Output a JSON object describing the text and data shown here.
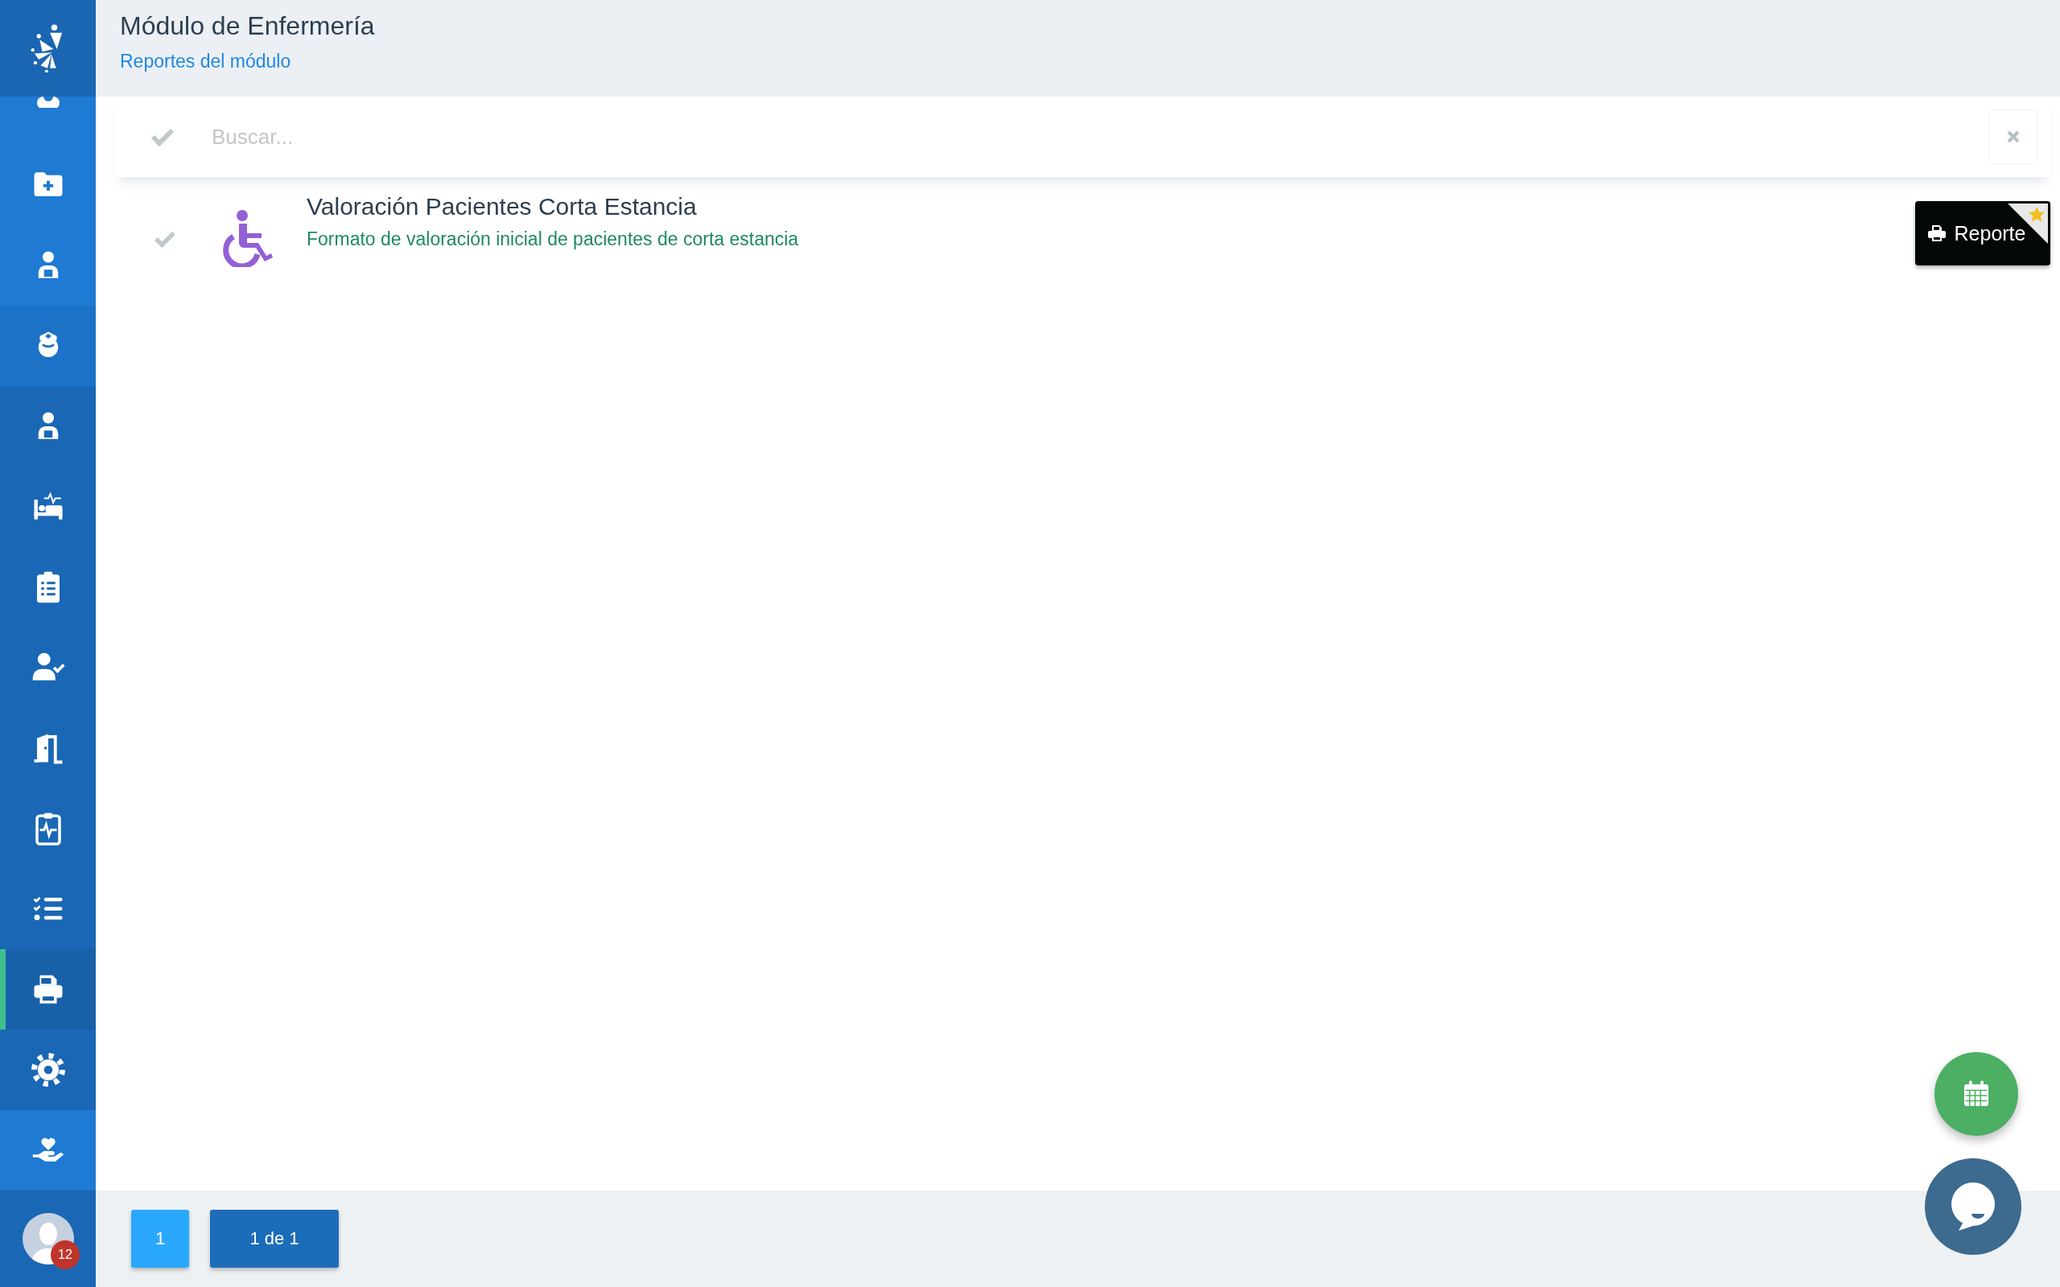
{
  "sidebar": {
    "items": [
      {
        "color": "#1e7ad2",
        "selected": false
      },
      {
        "color": "#1e7ad2",
        "selected": false
      },
      {
        "color": "#1e7ad2",
        "selected": false
      },
      {
        "color": "#1b72c6",
        "selected": false
      },
      {
        "color": "#1a67b5",
        "selected": false
      },
      {
        "color": "#1a67b5",
        "selected": false
      },
      {
        "color": "#1a67b5",
        "selected": false
      },
      {
        "color": "#1a67b5",
        "selected": false
      },
      {
        "color": "#1a67b5",
        "selected": false
      },
      {
        "color": "#1a67b5",
        "selected": false
      },
      {
        "color": "#1a67b5",
        "selected": false
      },
      {
        "color": "#1860a8",
        "selected": true
      },
      {
        "color": "#1a67b5",
        "selected": false
      },
      {
        "color": "#1e7ad2",
        "selected": false
      }
    ],
    "user": {
      "badge": "12"
    }
  },
  "header": {
    "title": "Módulo de Enfermería",
    "subtitle": "Reportes del módulo"
  },
  "search": {
    "placeholder": "Buscar..."
  },
  "reports": [
    {
      "title": "Valoración Pacientes Corta Estancia",
      "description": "Formato de valoración inicial de pacientes de corta estancia",
      "button": "Reporte",
      "favorite": true
    }
  ],
  "pagination": {
    "pages": [
      {
        "label": "1",
        "selected": true
      }
    ],
    "summary": "1 de 1"
  }
}
